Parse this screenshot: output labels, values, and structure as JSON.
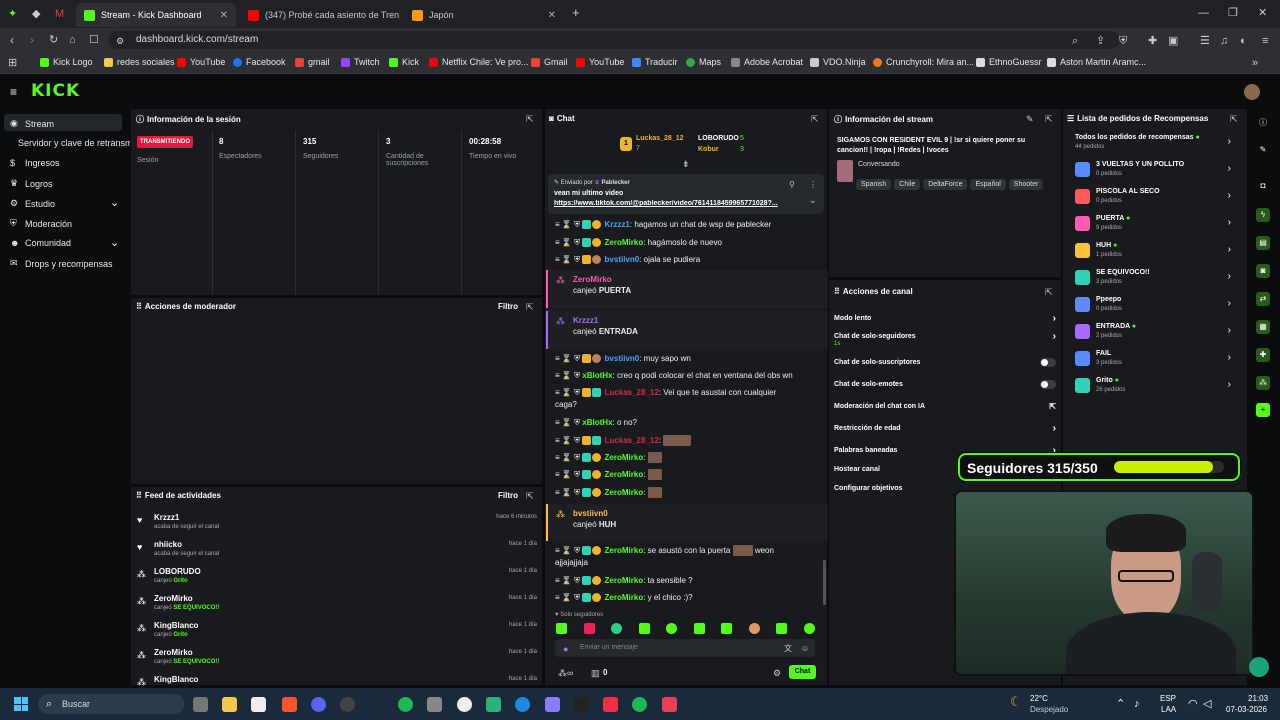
{
  "browser": {
    "tabs": [
      {
        "label": "Stream - Kick Dashboard",
        "color": "#53fc18"
      },
      {
        "label": "(347) Probé cada asiento de Tren - Yo",
        "color": "#ff0000"
      },
      {
        "label": "Japón",
        "color": "#ff9a00"
      }
    ],
    "url": "dashboard.kick.com/stream",
    "bookmarks": [
      {
        "label": "Kick Logo",
        "color": "#53fc18"
      },
      {
        "label": "redes sociales",
        "color": "#f2c94c"
      },
      {
        "label": "YouTube",
        "color": "#ff0000"
      },
      {
        "label": "Facebook",
        "color": "#1877f2"
      },
      {
        "label": "gmail",
        "color": "#ea4335"
      },
      {
        "label": "Twitch",
        "color": "#9146ff"
      },
      {
        "label": "Kick",
        "color": "#53fc18"
      },
      {
        "label": "Netflix Chile: Ve pro...",
        "color": "#e50914"
      },
      {
        "label": "Gmail",
        "color": "#ea4335"
      },
      {
        "label": "YouTube",
        "color": "#ff0000"
      },
      {
        "label": "Traducir",
        "color": "#4285f4"
      },
      {
        "label": "Maps",
        "color": "#34a853"
      },
      {
        "label": "Adobe Acrobat",
        "color": "#888888"
      },
      {
        "label": "VDO.Ninja",
        "color": "#cccccc"
      },
      {
        "label": "Crunchyroll: Mira an...",
        "color": "#f47521"
      },
      {
        "label": "EthnoGuessr",
        "color": "#dddddd"
      },
      {
        "label": "Aston Martin Aramc...",
        "color": "#dddddd"
      }
    ]
  },
  "kick": {
    "logo": "KICK"
  },
  "sidebar": {
    "items": [
      {
        "label": "Stream",
        "icon": "stream-icon"
      },
      {
        "label": "Servidor y clave de retransm"
      },
      {
        "label": "Ingresos",
        "icon": "money-icon"
      },
      {
        "label": "Logros",
        "icon": "trophy-icon"
      },
      {
        "label": "Estudio",
        "icon": "studio-icon"
      },
      {
        "label": "Moderación",
        "icon": "shield-icon"
      },
      {
        "label": "Comunidad",
        "icon": "people-icon"
      },
      {
        "label": "Drops y recompensas",
        "icon": "gift-icon"
      }
    ]
  },
  "session": {
    "title": "Información de la sesión",
    "status": "TRANSMITIENDO",
    "status_label": "Sesión",
    "viewers": "8",
    "viewers_label": "Espectadores",
    "followers": "315",
    "followers_label": "Seguidores",
    "subs": "3",
    "subs_label": "Cantidad de suscripciones",
    "time": "00:28:58",
    "time_label": "Tiempo en vivo"
  },
  "modactions": {
    "title": "Acciones de moderador",
    "filter": "Filtro"
  },
  "feed": {
    "title": "Feed de actividades",
    "filter": "Filtro",
    "items": [
      {
        "name": "Krzzz1",
        "sub": "acaba de seguir el canal",
        "reward": "",
        "time": "hace 6 minutos",
        "icon": "heart-icon"
      },
      {
        "name": "nhiicko",
        "sub": "acaba de seguir el canal",
        "reward": "",
        "time": "hace 1 día",
        "icon": "heart-icon"
      },
      {
        "name": "LOBORUDO",
        "sub": "canjeó ",
        "reward": "Grito",
        "time": "hace 1 día",
        "icon": "points-icon"
      },
      {
        "name": "ZeroMirko",
        "sub": "canjeó ",
        "reward": "SE EQUIVOCO!!",
        "time": "hace 1 día",
        "icon": "points-icon"
      },
      {
        "name": "KingBlanco",
        "sub": "canjeó ",
        "reward": "Grito",
        "time": "hace 1 día",
        "icon": "points-icon"
      },
      {
        "name": "ZeroMirko",
        "sub": "canjeó ",
        "reward": "SE EQUIVOCO!!",
        "time": "hace 1 día",
        "icon": "points-icon"
      },
      {
        "name": "KingBlanco",
        "sub": "",
        "reward": "",
        "time": "hace 1 día",
        "icon": "points-icon"
      }
    ]
  },
  "chat": {
    "title": "Chat",
    "top": [
      {
        "name": "Luckas_28_12",
        "count": "7"
      },
      {
        "name": "LOBORUDO",
        "count": "5"
      },
      {
        "name": "Kobur",
        "count": "3"
      }
    ],
    "pinned": {
      "by_label": "Enviado por",
      "by": "Pablecker",
      "text": "vean mi ultimo video",
      "link": "https://www.tiktok.com/@pablecker/video/7614118459965771028?..."
    },
    "lines": [
      {
        "user": "Krzzz1",
        "color": "#4aa3ff",
        "msg": ": hagamos un chat de wsp de pablecker"
      },
      {
        "user": "ZeroMirko",
        "color": "#53fc18",
        "msg": ": hagámoslo de nuevo"
      },
      {
        "user": "bvstiivn0",
        "color": "#4aa3ff",
        "msg": ": ojala se pudiera"
      }
    ],
    "redeem1": {
      "user": "ZeroMirko",
      "verb": "canjeó",
      "reward": "PUERTA",
      "color": "#ff5ab4"
    },
    "redeem2": {
      "user": "Krzzz1",
      "verb": "canjeó",
      "reward": "ENTRADA",
      "color": "#a66cff"
    },
    "lines2": [
      {
        "user": "bvstiivn0",
        "color": "#4aa3ff",
        "msg": ": muy sapo wn"
      },
      {
        "user": "xBlotHx",
        "color": "#53fc18",
        "msg": ": creo q podi colocar el chat en ventana del obs wn"
      },
      {
        "user": "Luckas_28_12",
        "color": "#e0254a",
        "msg": ": Vei que te asustai con cualquier"
      },
      {
        "user": "",
        "color": "#eeeeee",
        "msg": "caga?"
      },
      {
        "user": "xBlotHx",
        "color": "#53fc18",
        "msg": ": o no?"
      },
      {
        "user": "Luckas_28_12",
        "color": "#e0254a",
        "msg": ":"
      },
      {
        "user": "ZeroMirko",
        "color": "#53fc18",
        "msg": ":"
      },
      {
        "user": "ZeroMirko",
        "color": "#53fc18",
        "msg": ":"
      },
      {
        "user": "ZeroMirko",
        "color": "#53fc18",
        "msg": ":"
      }
    ],
    "redeem3": {
      "user": "bvstiivn0",
      "verb": "canjeó",
      "reward": "HUH",
      "color": "#ffbf3f"
    },
    "lines3": [
      {
        "user": "ZeroMirko",
        "color": "#53fc18",
        "msg": ": se asustó con la puerta",
        "after": " weon"
      },
      {
        "user": "",
        "color": "#eeeeee",
        "msg": "ajjajajjaja"
      },
      {
        "user": "ZeroMirko",
        "color": "#53fc18",
        "msg": ": ta sensible ?"
      },
      {
        "user": "ZeroMirko",
        "color": "#53fc18",
        "msg": ": y el chico :)?"
      }
    ],
    "mode_label": "Solo seguidores",
    "placeholder": "Enviar un mensaje",
    "points": "0",
    "send": "Chat"
  },
  "streaminfo": {
    "title": "Información del stream",
    "stream_title": "SIGAMOS CON RESIDENT EVIL 9 | !sr si quiere poner su cancion!! | !ropa | !Redes | !voces",
    "category": "Conversando",
    "tags": [
      "Spanish",
      "Chile",
      "DeltaForce",
      "Español",
      "Shooter"
    ]
  },
  "channel": {
    "title": "Acciones de canal",
    "items": [
      {
        "label": "Modo lento",
        "ctrl": "chevron",
        "sub": ""
      },
      {
        "label": "Chat de solo-seguidores",
        "ctrl": "chevron",
        "sub": "1s"
      },
      {
        "label": "Chat de solo-suscriptores",
        "ctrl": "toggle",
        "sub": ""
      },
      {
        "label": "Chat de solo-emotes",
        "ctrl": "toggle",
        "sub": ""
      },
      {
        "label": "Moderación del chat con IA",
        "ctrl": "ext",
        "sub": ""
      },
      {
        "label": "Restricción de edad",
        "ctrl": "chevron",
        "sub": ""
      },
      {
        "label": "Palabras baneadas",
        "ctrl": "chevron",
        "sub": ""
      },
      {
        "label": "Hostear canal",
        "ctrl": "chevron",
        "sub": ""
      },
      {
        "label": "Configurar objetivos",
        "ctrl": "chevron",
        "sub": ""
      }
    ]
  },
  "rewards": {
    "title": "Lista de pedidos de Recompensas",
    "all": "Todos los pedidos de recompensas",
    "all_count": "44 pedidos",
    "items": [
      {
        "name": "3 VUELTAS Y UN POLLITO",
        "count": "0 pedidos",
        "color": "#5b8cff",
        "dot": false
      },
      {
        "name": "PISCOLA AL SECO",
        "count": "0 pedidos",
        "color": "#ff5a5a",
        "dot": false
      },
      {
        "name": "PUERTA",
        "count": "9 pedidos",
        "color": "#ff5ab4",
        "dot": true
      },
      {
        "name": "HUH",
        "count": "1 pedidos",
        "color": "#ffbf3f",
        "dot": true
      },
      {
        "name": "SE EQUIVOCO!!",
        "count": "3 pedidos",
        "color": "#2ed3b7",
        "dot": false
      },
      {
        "name": "Ppeepo",
        "count": "0 pedidos",
        "color": "#5b8cff",
        "dot": false
      },
      {
        "name": "ENTRADA",
        "count": "2 pedidos",
        "color": "#a66cff",
        "dot": true
      },
      {
        "name": "FAIL",
        "count": "3 pedidos",
        "color": "#5b8cff",
        "dot": false
      },
      {
        "name": "Grito",
        "count": "26 pedidos",
        "color": "#2ed3b7",
        "dot": true
      }
    ]
  },
  "overlay": {
    "follow_label": "Seguidores 315/350",
    "follow_progress": 0.9
  },
  "taskbar": {
    "search": "Buscar",
    "weather": "22°C",
    "weather_sub": "Despejado",
    "lang": "ESP",
    "lang_sub": "LAA",
    "time": "21:03",
    "date": "07-03-2026"
  }
}
